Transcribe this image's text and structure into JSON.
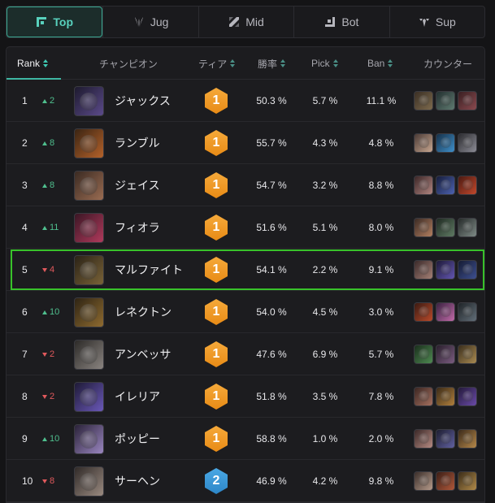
{
  "roles": [
    {
      "label": "Top",
      "icon": "top-lane-icon",
      "active": true
    },
    {
      "label": "Jug",
      "icon": "jungle-icon",
      "active": false
    },
    {
      "label": "Mid",
      "icon": "mid-lane-icon",
      "active": false
    },
    {
      "label": "Bot",
      "icon": "bot-lane-icon",
      "active": false
    },
    {
      "label": "Sup",
      "icon": "support-icon",
      "active": false
    }
  ],
  "columns": {
    "rank": "Rank",
    "champion": "チャンピオン",
    "tier": "ティア",
    "winrate": "勝率",
    "pick": "Pick",
    "ban": "Ban",
    "counter": "カウンター"
  },
  "rows": [
    {
      "rank": "1",
      "delta": "2",
      "dir": "up",
      "name": "ジャックス",
      "tier": "1",
      "win": "50.3 %",
      "pick": "5.7 %",
      "ban": "11.1 %",
      "portrait": [
        "#1d1a2e",
        "#5b4a8a"
      ],
      "counters": [
        [
          "#3a2f24",
          "#7d6a4d"
        ],
        [
          "#233030",
          "#5f7a70"
        ],
        [
          "#3a1f22",
          "#8a4a4f"
        ]
      ]
    },
    {
      "rank": "2",
      "delta": "8",
      "dir": "up",
      "name": "ランブル",
      "tier": "1",
      "win": "55.7 %",
      "pick": "4.3 %",
      "ban": "4.8 %",
      "portrait": [
        "#3a2413",
        "#b5622a"
      ],
      "counters": [
        [
          "#4a3a35",
          "#c7a690"
        ],
        [
          "#163048",
          "#3f8fc9"
        ],
        [
          "#2c2c30",
          "#8b8b95"
        ]
      ]
    },
    {
      "rank": "3",
      "delta": "8",
      "dir": "up",
      "name": "ジェイス",
      "tier": "1",
      "win": "54.7 %",
      "pick": "3.2 %",
      "ban": "8.8 %",
      "portrait": [
        "#3a2a22",
        "#9a6c52"
      ],
      "counters": [
        [
          "#3b2627",
          "#b08580"
        ],
        [
          "#161d3a",
          "#4d62b0"
        ],
        [
          "#4a1a12",
          "#c2482c"
        ]
      ]
    },
    {
      "rank": "4",
      "delta": "11",
      "dir": "up",
      "name": "フィオラ",
      "tier": "1",
      "win": "51.6 %",
      "pick": "5.1 %",
      "ban": "8.0 %",
      "portrait": [
        "#3a1624",
        "#b03a5c"
      ],
      "counters": [
        [
          "#3a2a24",
          "#b27f60"
        ],
        [
          "#1f2a22",
          "#5f7a63"
        ],
        [
          "#262b2a",
          "#7e8a86"
        ]
      ]
    },
    {
      "rank": "5",
      "delta": "4",
      "dir": "down",
      "name": "マルファイト",
      "tier": "1",
      "win": "54.1 %",
      "pick": "2.2 %",
      "ban": "9.1 %",
      "portrait": [
        "#2a2216",
        "#7a6338"
      ],
      "counters": [
        [
          "#3a2a2a",
          "#a47f75"
        ],
        [
          "#1e1a38",
          "#6255b0"
        ],
        [
          "#161c34",
          "#3d4f8f"
        ]
      ]
    },
    {
      "rank": "6",
      "delta": "10",
      "dir": "up",
      "name": "レネクトン",
      "tier": "1",
      "win": "54.0 %",
      "pick": "4.5 %",
      "ban": "3.0 %",
      "portrait": [
        "#2e2414",
        "#8f6b30"
      ],
      "counters": [
        [
          "#3a1a12",
          "#b84a2a"
        ],
        [
          "#3a2240",
          "#c06aa8"
        ],
        [
          "#1f2428",
          "#626e78"
        ]
      ]
    },
    {
      "rank": "7",
      "delta": "2",
      "dir": "down",
      "name": "アンベッサ",
      "tier": "1",
      "win": "47.6 %",
      "pick": "6.9 %",
      "ban": "5.7 %",
      "portrait": [
        "#2c2a28",
        "#8a8480"
      ],
      "counters": [
        [
          "#1a2e1c",
          "#4f8a52"
        ],
        [
          "#2a1f2c",
          "#7a5c80"
        ],
        [
          "#3a2e1c",
          "#a88a52"
        ]
      ]
    },
    {
      "rank": "8",
      "delta": "2",
      "dir": "down",
      "name": "イレリア",
      "tier": "1",
      "win": "51.8 %",
      "pick": "3.5 %",
      "ban": "7.8 %",
      "portrait": [
        "#1e1a36",
        "#6a58b8"
      ],
      "counters": [
        [
          "#3a2622",
          "#a5705f"
        ],
        [
          "#3a2a18",
          "#b0803c"
        ],
        [
          "#241a3a",
          "#6a4aa8"
        ]
      ]
    },
    {
      "rank": "9",
      "delta": "10",
      "dir": "up",
      "name": "ポッピー",
      "tier": "1",
      "win": "58.8 %",
      "pick": "1.0 %",
      "ban": "2.0 %",
      "portrait": [
        "#2a2238",
        "#9a86c0"
      ],
      "counters": [
        [
          "#3a2827",
          "#b58a82"
        ],
        [
          "#1e1e30",
          "#6060a0"
        ],
        [
          "#3a2a1a",
          "#b5884a"
        ]
      ]
    },
    {
      "rank": "10",
      "delta": "8",
      "dir": "down",
      "name": "サーヘン",
      "tier": "2",
      "win": "46.9 %",
      "pick": "4.2 %",
      "ban": "9.8 %",
      "portrait": [
        "#302a28",
        "#9a8a80"
      ],
      "counters": [
        [
          "#3a2e2a",
          "#b59a8a"
        ],
        [
          "#3a1e16",
          "#b0583a"
        ],
        [
          "#3a2c18",
          "#b08a4a"
        ]
      ]
    }
  ]
}
